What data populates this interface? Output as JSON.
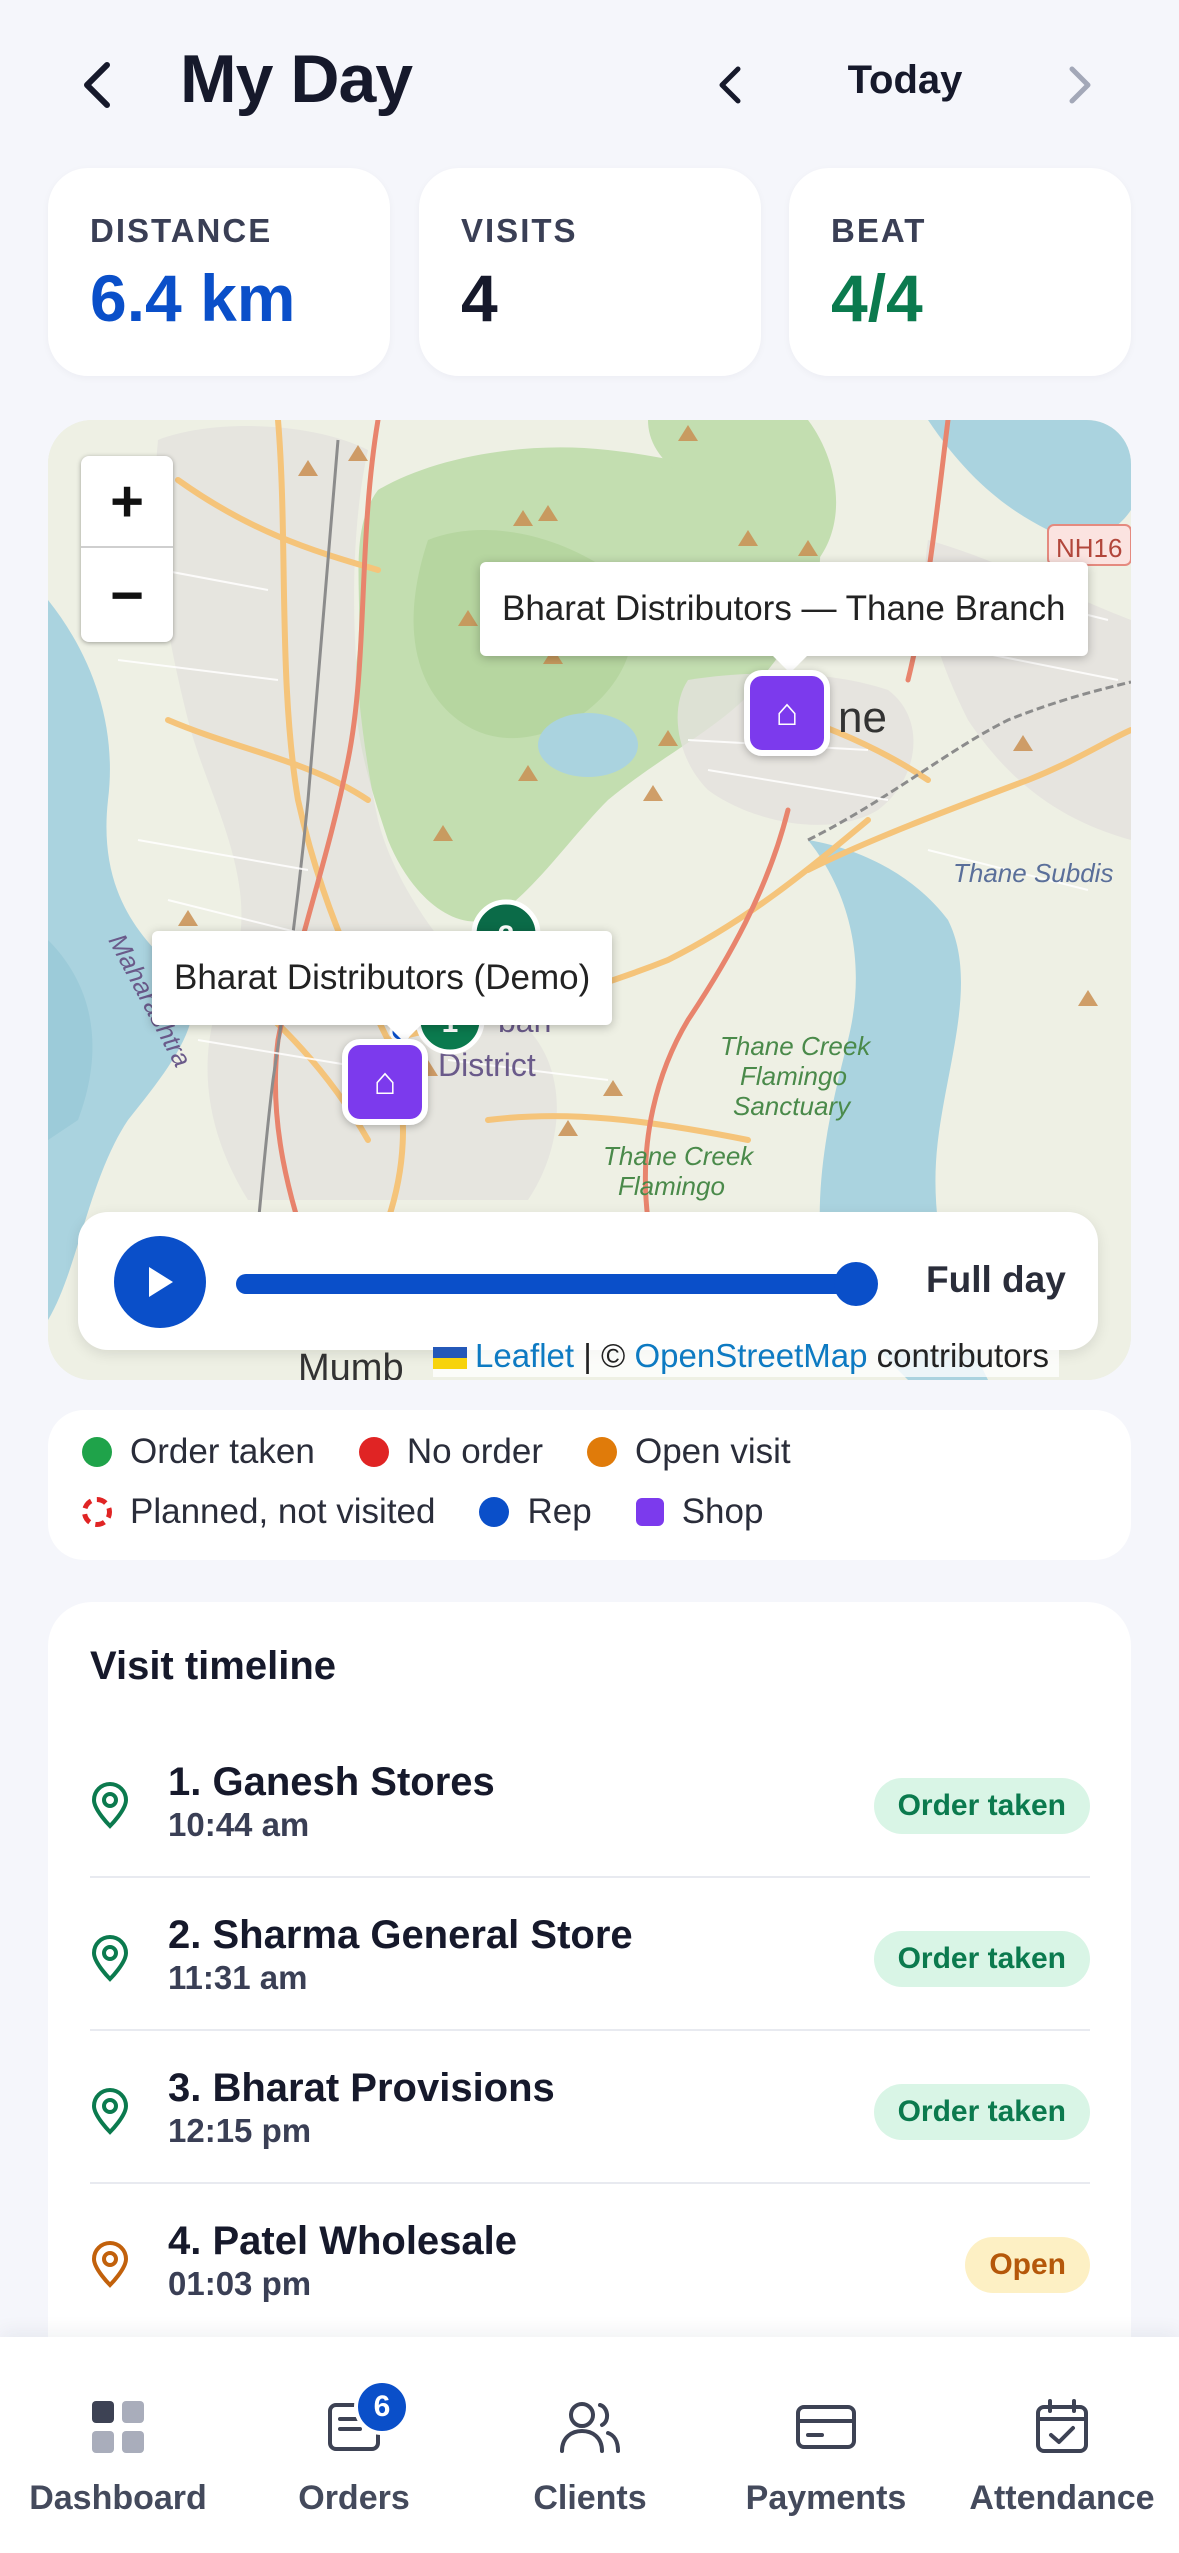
{
  "header": {
    "title": "My Day",
    "date_label": "Today"
  },
  "stats": [
    {
      "label": "DISTANCE",
      "value": "6.4 km",
      "color": "#0a4fc9"
    },
    {
      "label": "VISITS",
      "value": "4",
      "color": "#16192b"
    },
    {
      "label": "BEAT",
      "value": "4/4",
      "color": "#0b7a4e"
    }
  ],
  "map": {
    "zoom_in_label": "+",
    "zoom_out_label": "−",
    "tooltip_thane": "Bharat Distributors — Thane Branch",
    "tooltip_demo": "Bharat Distributors (Demo)",
    "visit_marker_labels": [
      "1",
      "2"
    ],
    "place_labels": {
      "nh": "NH16",
      "thane": "ne",
      "thane_subdis": "Thane Subdis",
      "creek": "Thane Creek",
      "flamingo": "Flamingo",
      "sanctuary": "Sanctuary",
      "creek2": "Thane Creek",
      "flamingo2": "Flamingo",
      "district": "District",
      "sub": "ban",
      "maha": "Maharashtra",
      "mumb": "Mumb"
    },
    "playback": {
      "range_label": "Full day",
      "progress": 1.0
    },
    "attribution": {
      "leaflet": "Leaflet",
      "sep": " | © ",
      "osm": "OpenStreetMap",
      "suffix": " contributors"
    }
  },
  "legend": {
    "items": [
      {
        "label": "Order taken",
        "color": "#1fa34a",
        "shape": "dot"
      },
      {
        "label": "No order",
        "color": "#e02424",
        "shape": "dot"
      },
      {
        "label": "Open visit",
        "color": "#e07b0a",
        "shape": "dot"
      },
      {
        "label": "Planned, not visited",
        "color": "#e02424",
        "shape": "ring"
      },
      {
        "label": "Rep",
        "color": "#0a4fc9",
        "shape": "dot"
      },
      {
        "label": "Shop",
        "color": "#7c3aed",
        "shape": "square"
      }
    ]
  },
  "timeline": {
    "title": "Visit timeline",
    "visits": [
      {
        "name": "1. Ganesh Stores",
        "time": "10:44 am",
        "status": "Order taken",
        "status_type": "order",
        "pin_color": "#0b7a4e"
      },
      {
        "name": "2. Sharma General Store",
        "time": "11:31 am",
        "status": "Order taken",
        "status_type": "order",
        "pin_color": "#0b7a4e"
      },
      {
        "name": "3. Bharat Provisions",
        "time": "12:15 pm",
        "status": "Order taken",
        "status_type": "order",
        "pin_color": "#0b7a4e"
      },
      {
        "name": "4. Patel Wholesale",
        "time": "01:03 pm",
        "status": "Open",
        "status_type": "open",
        "pin_color": "#c2610c"
      }
    ]
  },
  "bottom_nav": {
    "items": [
      {
        "label": "Dashboard",
        "icon": "grid-icon"
      },
      {
        "label": "Orders",
        "icon": "orders-icon",
        "badge": "6"
      },
      {
        "label": "Clients",
        "icon": "users-icon"
      },
      {
        "label": "Payments",
        "icon": "card-icon"
      },
      {
        "label": "Attendance",
        "icon": "calendar-check-icon"
      }
    ]
  }
}
